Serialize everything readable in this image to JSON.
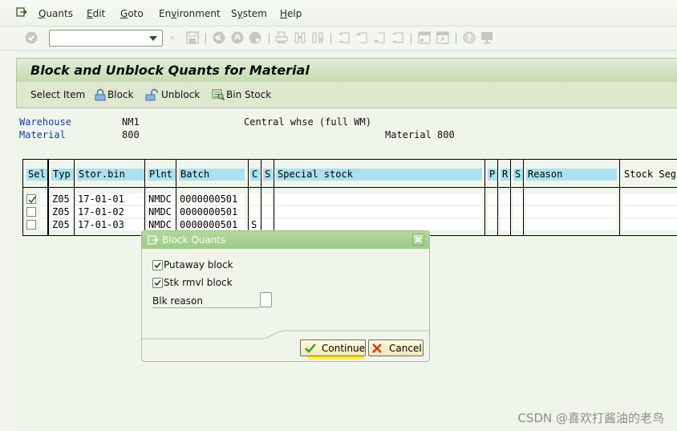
{
  "menubar": {
    "items": [
      {
        "label": "Quants",
        "mnemonic": "Q"
      },
      {
        "label": "Edit",
        "mnemonic": "E"
      },
      {
        "label": "Goto",
        "mnemonic": "G"
      },
      {
        "label": "Environment",
        "mnemonic": "v"
      },
      {
        "label": "System",
        "mnemonic": "y"
      },
      {
        "label": "Help",
        "mnemonic": "H"
      }
    ]
  },
  "toolbar": {
    "command_field_value": "",
    "icons": [
      "enter-icon",
      "back-double-icon",
      "save-icon",
      "back-icon",
      "exit-icon",
      "cancel-icon",
      "print-icon",
      "find-icon",
      "find-next-icon",
      "first-page-icon",
      "previous-page-icon",
      "next-page-icon",
      "last-page-icon",
      "create-session-icon",
      "shortcut-icon",
      "help-icon",
      "customize-layout-icon"
    ]
  },
  "page": {
    "title": "Block and Unblock Quants for Material"
  },
  "app_toolbar": {
    "select_item": "Select Item",
    "block": "Block",
    "unblock": "Unblock",
    "bin_stock": "Bin Stock"
  },
  "header": {
    "warehouse_label": "Warehouse",
    "warehouse_value": "NM1",
    "warehouse_desc": "Central whse (full WM)",
    "material_label": "Material",
    "material_value": "800",
    "material_desc": "Material 800"
  },
  "grid": {
    "columns": [
      "Sel",
      "Typ",
      "Stor.bin",
      "Plnt",
      "Batch",
      "C",
      "S",
      "Special stock",
      "P",
      "R",
      "S",
      "Reason",
      "Stock Seg"
    ],
    "rows": [
      {
        "selected": true,
        "typ": "Z05",
        "stor_bin": "17-01-01",
        "plnt": "NMDC",
        "batch": "0000000501",
        "c": "",
        "s": "",
        "special_stock": "",
        "p": "",
        "r": "",
        "s2": "",
        "reason": "",
        "stock_seg": ""
      },
      {
        "selected": false,
        "typ": "Z05",
        "stor_bin": "17-01-02",
        "plnt": "NMDC",
        "batch": "0000000501",
        "c": "",
        "s": "",
        "special_stock": "",
        "p": "",
        "r": "",
        "s2": "",
        "reason": "",
        "stock_seg": ""
      },
      {
        "selected": false,
        "typ": "Z05",
        "stor_bin": "17-01-03",
        "plnt": "NMDC",
        "batch": "0000000501",
        "c": "S",
        "s": "",
        "special_stock": "",
        "p": "",
        "r": "",
        "s2": "",
        "reason": "",
        "stock_seg": ""
      }
    ]
  },
  "dialog": {
    "title": "Block Quants",
    "putaway_block_label": "Putaway block",
    "putaway_block_checked": true,
    "stk_rmvl_block_label": "Stk rmvl block",
    "stk_rmvl_block_checked": true,
    "blk_reason_label": "Blk reason",
    "blk_reason_value": "",
    "continue_label": "Continue",
    "cancel_label": "Cancel"
  },
  "watermark": "CSDN @喜欢打酱油的老鸟"
}
